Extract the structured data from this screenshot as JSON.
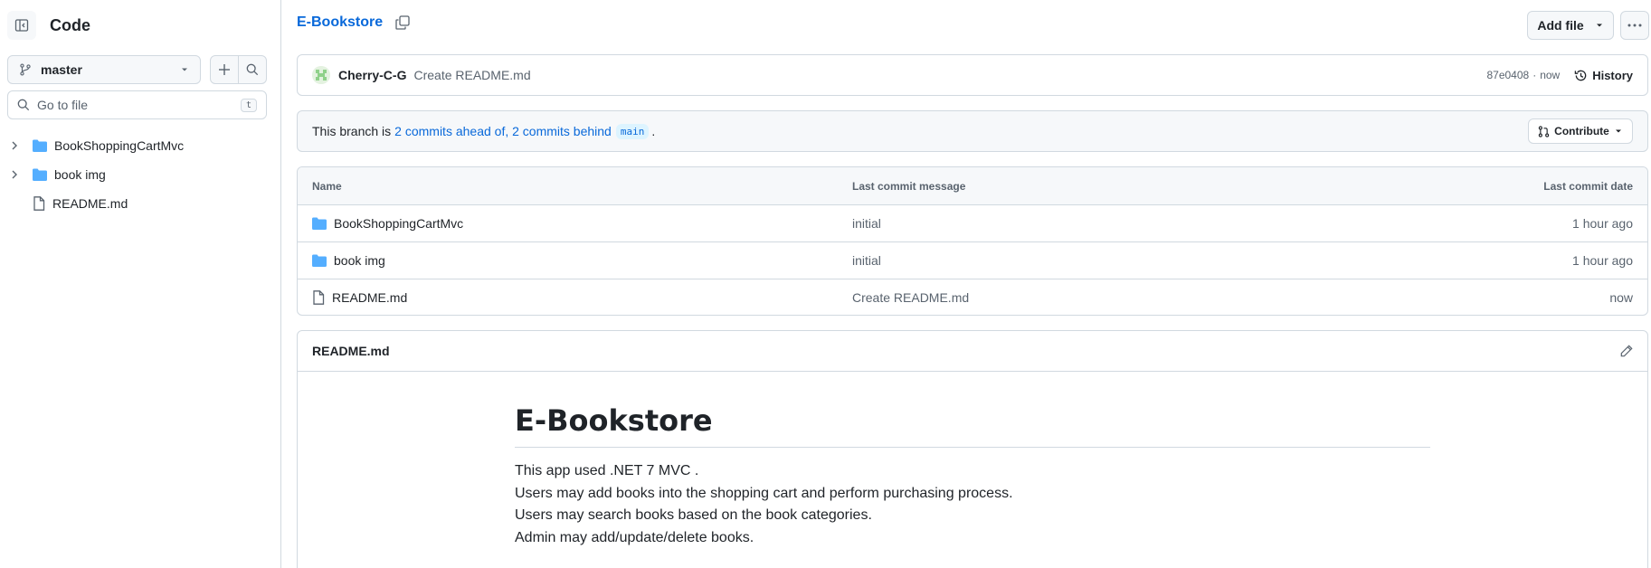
{
  "sidebar": {
    "title": "Code",
    "branch": "master",
    "search_placeholder": "Go to file",
    "search_shortcut": "t",
    "tree": [
      {
        "name": "BookShoppingCartMvc",
        "type": "folder"
      },
      {
        "name": "book img",
        "type": "folder"
      },
      {
        "name": "README.md",
        "type": "file"
      }
    ]
  },
  "header": {
    "repo_name": "E-Bookstore",
    "add_file_label": "Add file"
  },
  "commit": {
    "author": "Cherry-C-G",
    "message": "Create README.md",
    "hash": "87e0408",
    "separator": "·",
    "time": "now",
    "history_label": "History"
  },
  "branch_status": {
    "prefix": "This branch is",
    "link": "2 commits ahead of, 2 commits behind",
    "base": "main",
    "suffix": ".",
    "contribute_label": "Contribute"
  },
  "files": {
    "columns": [
      "Name",
      "Last commit message",
      "Last commit date"
    ],
    "rows": [
      {
        "name": "BookShoppingCartMvc",
        "type": "folder",
        "message": "initial",
        "date": "1 hour ago"
      },
      {
        "name": "book img",
        "type": "folder",
        "message": "initial",
        "date": "1 hour ago"
      },
      {
        "name": "README.md",
        "type": "file",
        "message": "Create README.md",
        "date": "now"
      }
    ]
  },
  "readme": {
    "filename": "README.md",
    "heading": "E-Bookstore",
    "lines": [
      "This app used .NET 7 MVC .",
      "Users may add books into the shopping cart and perform purchasing process.",
      "Users may search books based on the book categories.",
      "Admin may add/update/delete books."
    ]
  },
  "colors": {
    "accent": "#0969da",
    "folder": "#54aeff",
    "border": "#d1d9e0",
    "muted": "#59636e"
  }
}
